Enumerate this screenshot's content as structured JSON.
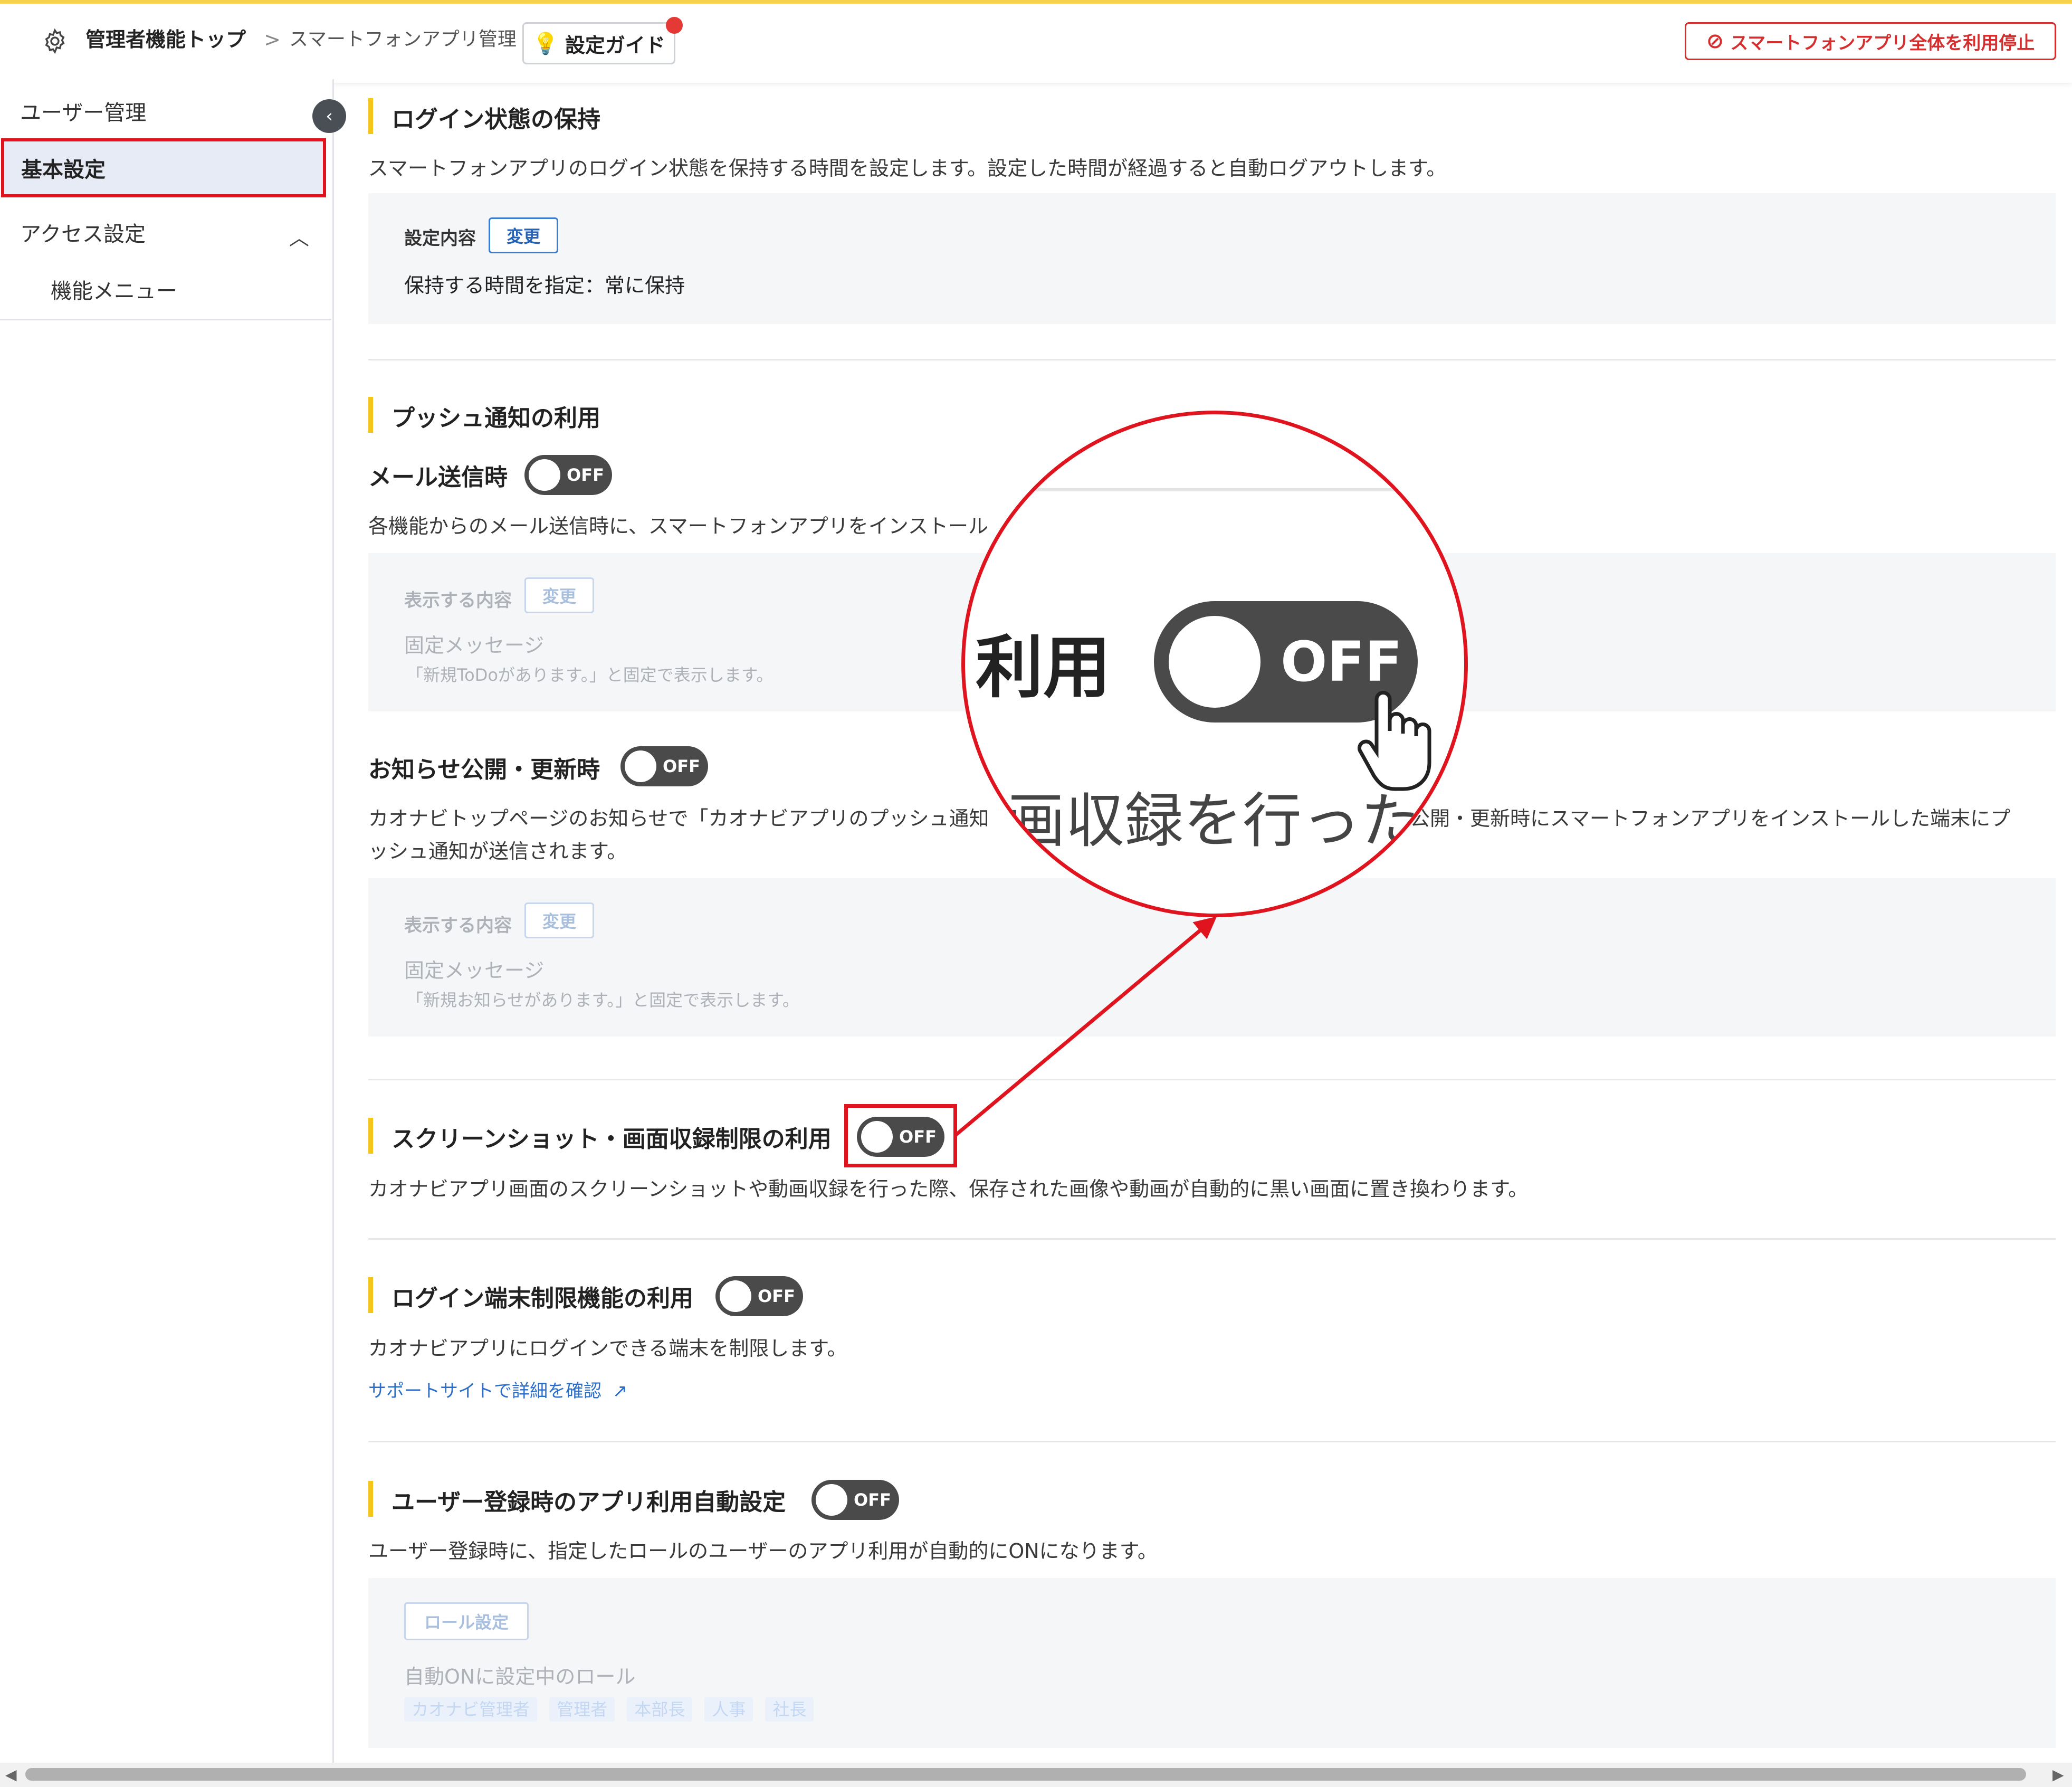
{
  "header": {
    "breadcrumb_root": "管理者機能トップ",
    "breadcrumb_sep": ">",
    "breadcrumb_current": "スマートフォンアプリ管理",
    "guide_button": "設定ガイド",
    "stop_button": "スマートフォンアプリ全体を利用停止"
  },
  "sidebar": {
    "items": [
      {
        "label": "ユーザー管理"
      },
      {
        "label": "基本設定"
      },
      {
        "label": "アクセス設定"
      },
      {
        "label": "機能メニュー"
      }
    ]
  },
  "sections": {
    "login": {
      "title": "ログイン状態の保持",
      "desc": "スマートフォンアプリのログイン状態を保持する時間を設定します。設定した時間が経過すると自動ログアウトします。",
      "panel_label": "設定内容",
      "change_button": "変更",
      "value": "保持する時間を指定：常に保持"
    },
    "push": {
      "title": "プッシュ通知の利用",
      "mail": {
        "title": "メール送信時",
        "toggle": "OFF",
        "desc": "各機能からのメール送信時に、スマートフォンアプリをインストール",
        "panel_label": "表示する内容",
        "change_button": "変更",
        "value": "固定メッセージ",
        "note": "「新規ToDoがあります。」と固定で表示します。"
      },
      "notice": {
        "title": "お知らせ公開・更新時",
        "toggle": "OFF",
        "desc1a": "カオナビトップページのお知らせで「カオナビアプリのプッシュ通知",
        "desc1b": "公開・更新時にスマートフォンアプリをインストールした端末にプ",
        "desc2": "ッシュ通知が送信されます。",
        "panel_label": "表示する内容",
        "change_button": "変更",
        "value": "固定メッセージ",
        "note": "「新規お知らせがあります。」と固定で表示します。"
      }
    },
    "screenshot": {
      "title": "スクリーンショット・画面収録制限の利用",
      "toggle": "OFF",
      "desc": "カオナビアプリ画面のスクリーンショットや動画収録を行った際、保存された画像や動画が自動的に黒い画面に置き換わります。"
    },
    "device": {
      "title": "ログイン端末制限機能の利用",
      "toggle": "OFF",
      "desc": "カオナビアプリにログインできる端末を制限します。",
      "link": "サポートサイトで詳細を確認"
    },
    "autoreg": {
      "title": "ユーザー登録時のアプリ利用自動設定",
      "toggle": "OFF",
      "desc": "ユーザー登録時に、指定したロールのユーザーのアプリ利用が自動的にONになります。",
      "role_button": "ロール設定",
      "panel_label": "自動ONに設定中のロール",
      "roles": [
        "カオナビ管理者",
        "管理者",
        "本部長",
        "人事",
        "社長"
      ]
    }
  },
  "zoom": {
    "text_left": "利用",
    "toggle": "OFF",
    "text_below": "画収録を行った"
  },
  "colors": {
    "accent_yellow": "#f5c518",
    "highlight_red": "#e0141e",
    "toggle_dark": "#4a4a4a",
    "link_blue": "#2b6ec9"
  }
}
